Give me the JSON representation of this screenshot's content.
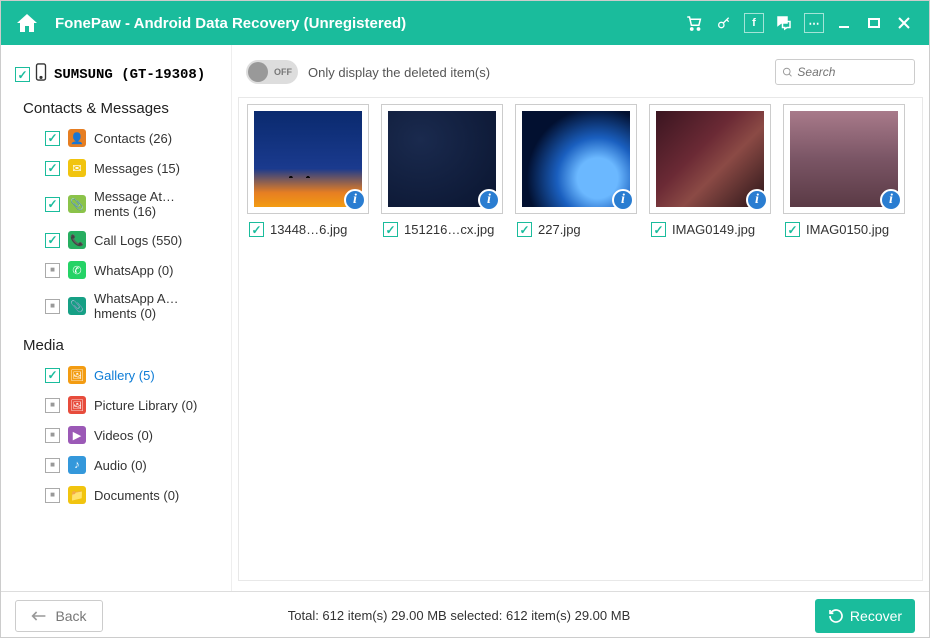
{
  "titlebar": {
    "title": "FonePaw - Android Data Recovery (Unregistered)"
  },
  "device": {
    "name": "SUMSUNG (GT-19308)"
  },
  "sections": {
    "contacts_title": "Contacts & Messages",
    "media_title": "Media"
  },
  "nav": {
    "contacts": {
      "label": "Contacts (26)"
    },
    "messages": {
      "label": "Messages (15)"
    },
    "msg_att": {
      "label": "Message At…ments (16)"
    },
    "call_logs": {
      "label": "Call Logs (550)"
    },
    "whatsapp": {
      "label": "WhatsApp (0)"
    },
    "whatsapp_att": {
      "label": "WhatsApp A…hments (0)"
    },
    "gallery": {
      "label": "Gallery (5)"
    },
    "pic_lib": {
      "label": "Picture Library (0)"
    },
    "videos": {
      "label": "Videos (0)"
    },
    "audio": {
      "label": "Audio (0)"
    },
    "documents": {
      "label": "Documents (0)"
    }
  },
  "toolbar": {
    "toggle_label": "OFF",
    "deleted_text": "Only display the deleted item(s)",
    "search_placeholder": "Search"
  },
  "thumbs": {
    "0": {
      "label": "13448…6.jpg"
    },
    "1": {
      "label": "151216…cx.jpg"
    },
    "2": {
      "label": "227.jpg"
    },
    "3": {
      "label": "IMAG0149.jpg"
    },
    "4": {
      "label": "IMAG0150.jpg"
    }
  },
  "footer": {
    "back": "Back",
    "status": "Total: 612 item(s) 29.00 MB   selected: 612 item(s) 29.00 MB",
    "recover": "Recover"
  }
}
